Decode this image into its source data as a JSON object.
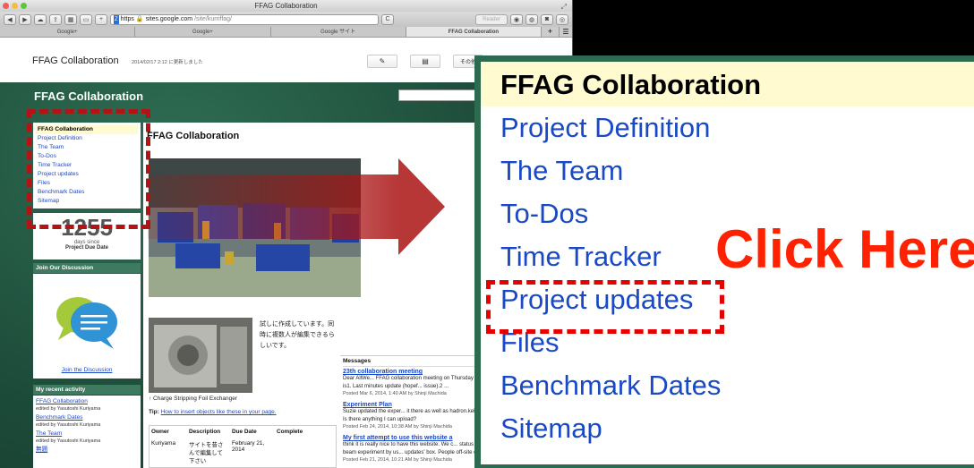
{
  "browser": {
    "window_title": "FFAG Collaboration",
    "url_scheme": "https",
    "url_host": "sites.google.com",
    "url_path": "/site/kurriffag/",
    "reader_label": "Reader",
    "tabs": [
      "Google+",
      "Google+",
      "Google サイト",
      "FFAG Collaboration"
    ],
    "tab_add": "+"
  },
  "site": {
    "title": "FFAG Collaboration",
    "updated": "2014/02/17 2:12 に更新しました",
    "more_label": "その他",
    "banner_title": "FFAG Collaboration"
  },
  "sidebar": {
    "nav": [
      "FFAG Collaboration",
      "Project Definition",
      "The Team",
      "To-Dos",
      "Time Tracker",
      "Project updates",
      "Files",
      "Benchmark Dates",
      "Sitemap"
    ],
    "counter": {
      "value": "1255",
      "label1": "days since",
      "label2": "Project Due Date"
    },
    "discussion_heading": "Join Our Discussion",
    "discussion_link": "Join the Discussion",
    "activity_heading": "My recent activity",
    "activity": [
      {
        "link": "FFAG Collaboration",
        "by": "edited by Yasutoshi Kuriyama"
      },
      {
        "link": "Benchmark Dates",
        "by": "edited by Yasutoshi Kuriyama"
      },
      {
        "link": "The Team",
        "by": "edited by Yasutoshi Kuriyama"
      },
      {
        "link": "無題",
        "by": ""
      }
    ]
  },
  "content": {
    "title": "FFAG Collaboration",
    "jp_text": "試しに作成しています。同時に複数人が編集できるらしいです。",
    "caption": "↑ Charge Stripping Foil Exchanger",
    "tip_label": "Tip:",
    "tip_link": "How to insert objects like these in your page.",
    "table": {
      "headers": [
        "Owner",
        "Description",
        "Due Date",
        "Complete"
      ],
      "row": [
        "Kuriyama",
        "サイトを昔さんで編集して下さい",
        "February 21, 2014",
        ""
      ]
    }
  },
  "messages": {
    "heading": "Messages",
    "items": [
      {
        "title": "23th collaboration meeting",
        "body": "Dear AllWe... FFAG collaboration meeting on Thursday 13 N... GMT. Agenda is1. Last minutes update (hopef... issue).2 ...",
        "posted": "Posted Mar 6, 2014, 1:40 AM by Shinji Machida"
      },
      {
        "title": "Experiment Plan",
        "body": "Suzie updated the exper... it there as well as hadron.kek.jp (later). Now I c... Is there anything I can upload?",
        "posted": "Posted Feb 24, 2014, 10:38 AM by Shinji Machida"
      },
      {
        "title": "My first attempt to use this website a",
        "body": "think it is really nice to have this website. We c... status of machine and beam experiment by us... updates' box. People off-site can ...",
        "posted": "Posted Feb 21, 2014, 10:21 AM by Shinji Machida"
      }
    ]
  },
  "zoom": {
    "nav": [
      "FFAG Collaboration",
      "Project Definition",
      "The Team",
      "To-Dos",
      "Time Tracker",
      "Project updates",
      "Files",
      "Benchmark Dates",
      "Sitemap"
    ],
    "callout": "Click Here"
  },
  "colors": {
    "link": "#1a49c5",
    "highlight": "#fffad0",
    "annotation_red": "#e60000",
    "site_green": "#2d6b50"
  }
}
